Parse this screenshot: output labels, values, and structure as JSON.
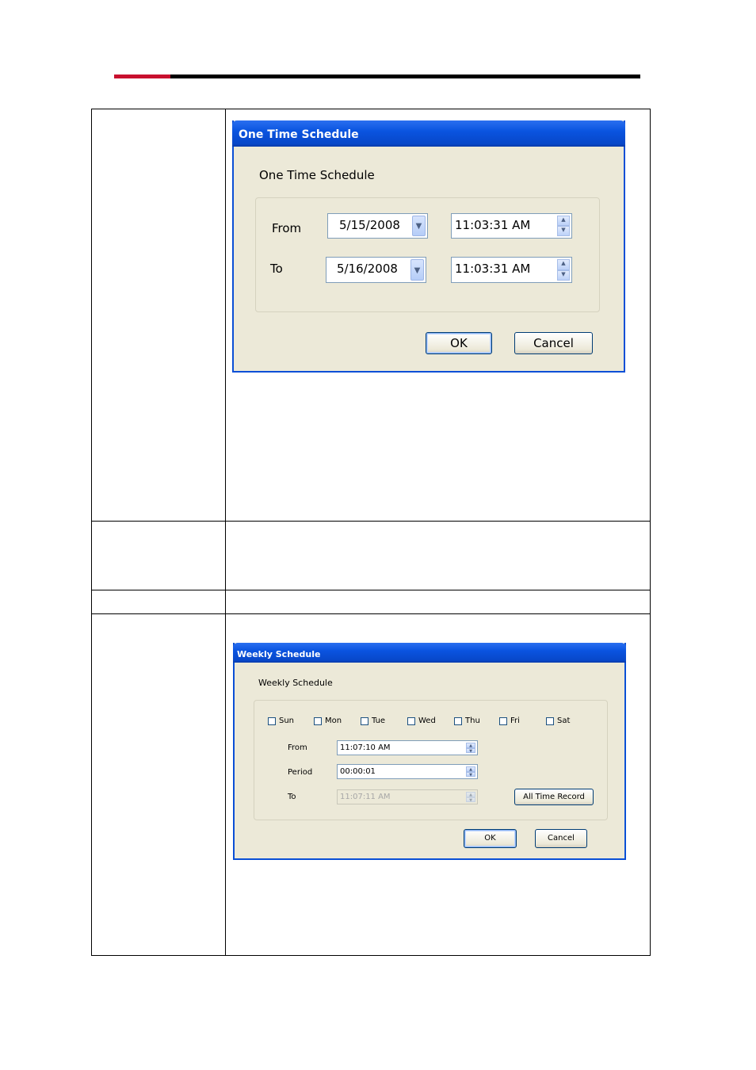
{
  "one_time_dialog": {
    "title": "One Time Schedule",
    "heading": "One Time Schedule",
    "from_label": "From",
    "to_label": "To",
    "from_date": "5/15/2008",
    "from_time": "11:03:31 AM",
    "to_date": "5/16/2008",
    "to_time": "11:03:31 AM",
    "ok_label": "OK",
    "cancel_label": "Cancel"
  },
  "weekly_dialog": {
    "title": "Weekly Schedule",
    "heading": "Weekly Schedule",
    "days": [
      "Sun",
      "Mon",
      "Tue",
      "Wed",
      "Thu",
      "Fri",
      "Sat"
    ],
    "from_label": "From",
    "period_label": "Period",
    "to_label": "To",
    "from_time": "11:07:10 AM",
    "period_value": "00:00:01",
    "to_time": "11:07:11 AM",
    "all_time_label": "All Time Record",
    "ok_label": "OK",
    "cancel_label": "Cancel"
  },
  "colors": {
    "accent_red": "#c8102e",
    "title_bar_blue": "#0a54e0",
    "dialog_face": "#ece9d8"
  },
  "icons": {
    "dropdown": "chevron-down-icon",
    "spinner": "spin-arrows-icon",
    "checkbox": "checkbox-icon"
  }
}
